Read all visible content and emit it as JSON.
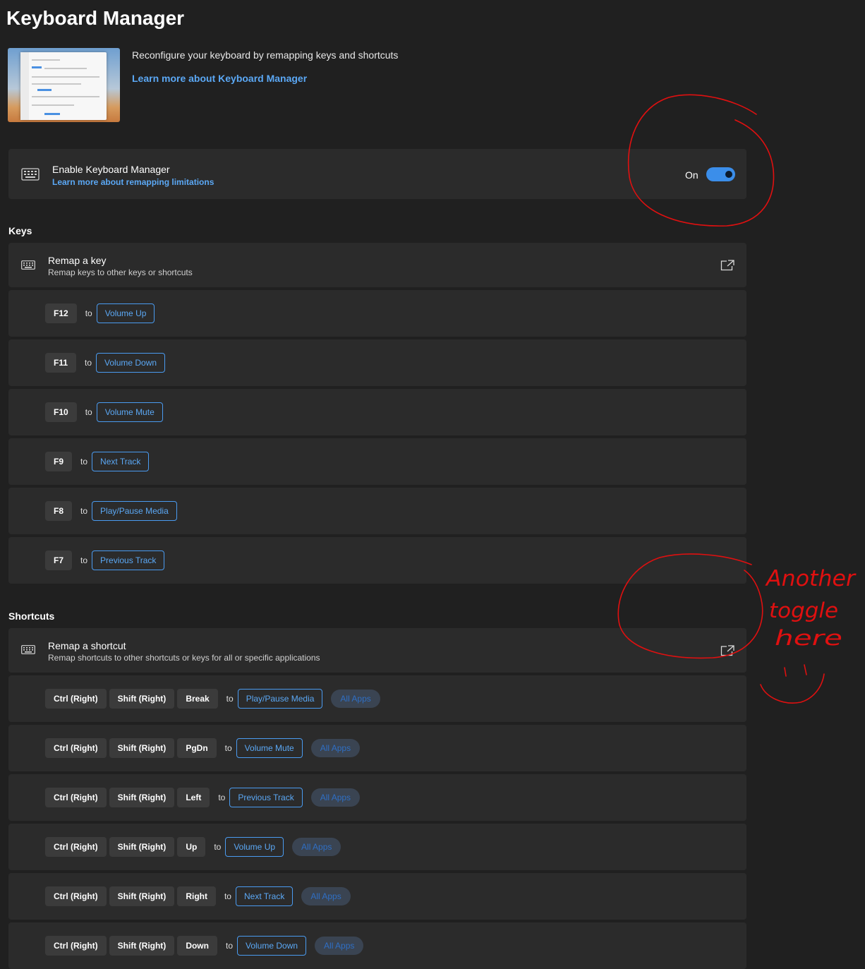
{
  "header": {
    "title": "Keyboard Manager",
    "description": "Reconfigure your keyboard by remapping keys and shortcuts",
    "learn_more": "Learn more about Keyboard Manager"
  },
  "enable": {
    "title": "Enable Keyboard Manager",
    "sub_link": "Learn more about remapping limitations",
    "toggle_label": "On",
    "toggle_on": true
  },
  "keys": {
    "section_title": "Keys",
    "remap_title": "Remap a key",
    "remap_sub": "Remap keys to other keys or shortcuts",
    "to_label": "to",
    "mappings": [
      {
        "from": [
          "F12"
        ],
        "to": "Volume Up"
      },
      {
        "from": [
          "F11"
        ],
        "to": "Volume Down"
      },
      {
        "from": [
          "F10"
        ],
        "to": "Volume Mute"
      },
      {
        "from": [
          "F9"
        ],
        "to": "Next Track"
      },
      {
        "from": [
          "F8"
        ],
        "to": "Play/Pause Media"
      },
      {
        "from": [
          "F7"
        ],
        "to": "Previous Track"
      }
    ]
  },
  "shortcuts": {
    "section_title": "Shortcuts",
    "remap_title": "Remap a shortcut",
    "remap_sub": "Remap shortcuts to other shortcuts or keys for all or specific applications",
    "to_label": "to",
    "apps_label": "All Apps",
    "mappings": [
      {
        "from": [
          "Ctrl (Right)",
          "Shift (Right)",
          "Break"
        ],
        "to": "Play/Pause Media"
      },
      {
        "from": [
          "Ctrl (Right)",
          "Shift (Right)",
          "PgDn"
        ],
        "to": "Volume Mute"
      },
      {
        "from": [
          "Ctrl (Right)",
          "Shift (Right)",
          "Left"
        ],
        "to": "Previous Track"
      },
      {
        "from": [
          "Ctrl (Right)",
          "Shift (Right)",
          "Up"
        ],
        "to": "Volume Up"
      },
      {
        "from": [
          "Ctrl (Right)",
          "Shift (Right)",
          "Right"
        ],
        "to": "Next Track"
      },
      {
        "from": [
          "Ctrl (Right)",
          "Shift (Right)",
          "Down"
        ],
        "to": "Volume Down"
      }
    ]
  },
  "annotation": {
    "lines": [
      "Another",
      "toggle",
      "here"
    ],
    "color": "#e01010"
  },
  "colors": {
    "background": "#202020",
    "card": "#2b2b2b",
    "accent": "#3b8eea",
    "link": "#5ba8f5"
  },
  "icons": {
    "keyboard": "keyboard-icon",
    "external": "open-external-icon"
  }
}
